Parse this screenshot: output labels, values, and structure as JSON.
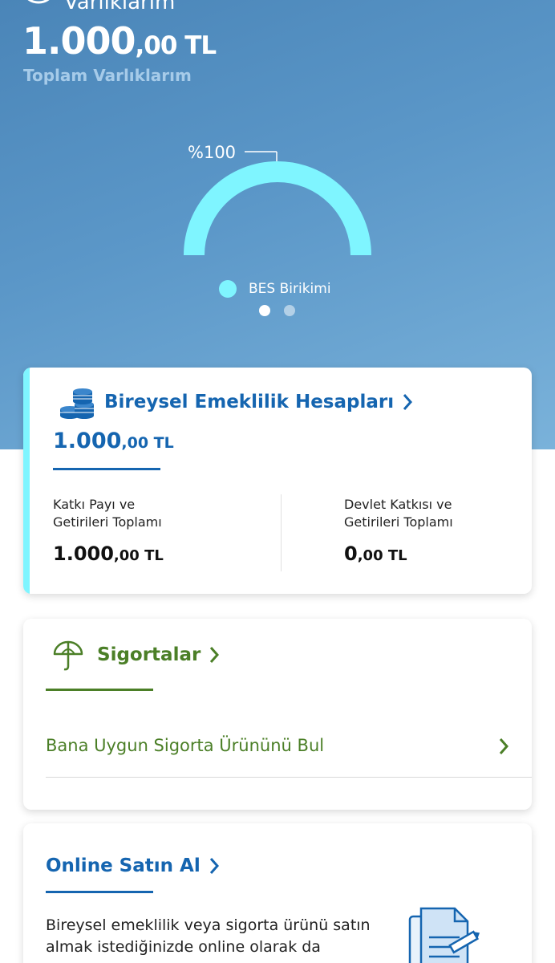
{
  "header": {
    "title_partial": "Varlıklarım",
    "total_amount_int": "1.000",
    "total_amount_dec": ",00 TL",
    "total_label": "Toplam Varlıklarım"
  },
  "gauge": {
    "percent_label": "%100",
    "value_percent": 100,
    "legend": [
      {
        "label": "BES Birikimi",
        "color": "#7ff5ff"
      }
    ],
    "pager": {
      "count": 2,
      "active_index": 0
    }
  },
  "bes_card": {
    "title": "Bireysel Emeklilik Hesapları",
    "amount_int": "1.000",
    "amount_dec": ",00 TL",
    "left": {
      "label_line1": "Katkı Payı ve",
      "label_line2": "Getirileri Toplamı",
      "amount_int": "1.000",
      "amount_dec": ",00 TL"
    },
    "right": {
      "label_line1": "Devlet Katkısı ve",
      "label_line2": "Getirileri Toplamı",
      "amount_int": "0",
      "amount_dec": ",00 TL"
    }
  },
  "sigorta_card": {
    "title": "Sigortalar",
    "row_label": "Bana Uygun Sigorta Ürününü Bul"
  },
  "online_card": {
    "title": "Online Satın Al",
    "desc_line1": "Bireysel emeklilik veya sigorta ürünü satın",
    "desc_line2": "almak istediğinizde online olarak da"
  },
  "colors": {
    "bes_blue": "#1565b0",
    "sigorta_green": "#4b7f27",
    "accent_cyan": "#7ff5ff"
  },
  "icons": {
    "chevron": "chevron-right-icon",
    "bes": "coins-icon",
    "sigorta": "umbrella-icon",
    "online": "document-pen-icon"
  }
}
